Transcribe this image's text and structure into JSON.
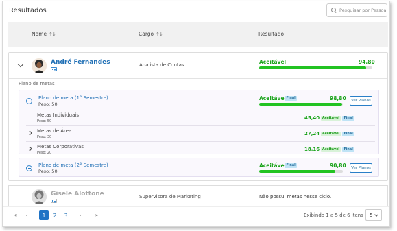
{
  "header": {
    "title": "Resultados",
    "search_placeholder": "Pesquisar por Pessoa"
  },
  "table": {
    "columns": [
      "Nome",
      "Cargo",
      "Resultado"
    ]
  },
  "people": [
    {
      "name": "André Fernandes",
      "role": "Analista de Contas",
      "status": "Aceitável",
      "score": "94,80",
      "progress": 0.948,
      "section_label": "Plano de metas",
      "plans": [
        {
          "title": "Plano de meta (1° Semestre)",
          "weight": "Peso: 50",
          "status": "Aceitável",
          "badge": "Final",
          "score": "98,80",
          "progress": 0.988,
          "button": "Ver Planos",
          "goals": [
            {
              "name": "Metas Individuais",
              "weight": "Peso: 50",
              "score": "45,40",
              "status": "Aceitável",
              "badge": "Final"
            },
            {
              "name": "Metas de Área",
              "weight": "Peso: 30",
              "score": "27,24",
              "status": "Aceitável",
              "badge": "Final"
            },
            {
              "name": "Metas Corporativas",
              "weight": "Peso: 20",
              "score": "18,16",
              "status": "Aceitável",
              "badge": "Final"
            }
          ]
        },
        {
          "title": "Plano de meta (2° Semestre)",
          "weight": "Peso: 50",
          "status": "Aceitável",
          "badge": "Final",
          "score": "90,80",
          "progress": 0.908,
          "button": "Ver Planos"
        }
      ]
    },
    {
      "name": "Gisele Alottone",
      "role": "Supervisora de Marketing",
      "result_text": "Não possui metas nesse ciclo."
    }
  ],
  "pagination": {
    "first": "«",
    "prev": "‹",
    "pages": [
      "1",
      "2",
      "3"
    ],
    "current": "1",
    "next": "›",
    "last": "»",
    "range_text": "Exibindo 1 a 5 de 6 itens",
    "page_size": "5"
  },
  "colors": {
    "accent": "#1f73c5",
    "success": "#22c322",
    "badge_final": "#bfe3f5"
  }
}
